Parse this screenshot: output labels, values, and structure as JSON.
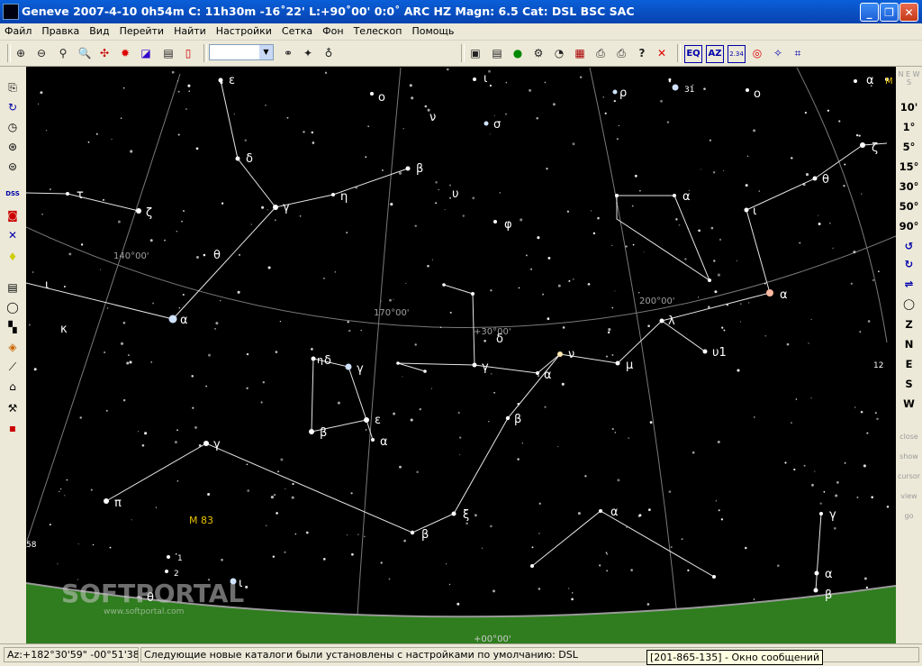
{
  "window": {
    "title": "Geneve 2007-4-10    0h54m C: 11h30m -16˚22' L:+90˚00' 0:0˚  ARC HZ  Magn: 6.5 Cat: DSL BSC SAC",
    "minimize": "_",
    "maximize": "❐",
    "close": "✕"
  },
  "menu": [
    "Файл",
    "Правка",
    "Вид",
    "Перейти",
    "Найти",
    "Настройки",
    "Сетка",
    "Фон",
    "Телескоп",
    "Помощь"
  ],
  "toolbar": {
    "combo_value": "",
    "buttons": [
      "zoom-in",
      "zoom-out",
      "zoom-fit",
      "find",
      "constellation",
      "sun",
      "night-mode",
      "info",
      "binoculars",
      "search-object",
      "search-person",
      "save",
      "text",
      "globe",
      "satellite",
      "clock",
      "calendar",
      "print",
      "print-setup",
      "help",
      "close",
      "eq",
      "az",
      "alt",
      "target",
      "constellation-lines"
    ],
    "eq_label": "EQ",
    "az_label": "AZ",
    "alt_label": "2.34"
  },
  "left_toolbar": [
    "copy",
    "refresh",
    "clock",
    "compass",
    "grid",
    "dss",
    "camera",
    "mirror",
    "bulb",
    "layers",
    "circle",
    "palette",
    "stats",
    "eyepiece",
    "telescope",
    "scope",
    "tools"
  ],
  "right_toolbar": {
    "fov": [
      "10'",
      "1°",
      "5°",
      "15°",
      "30°",
      "50°",
      "90°"
    ],
    "directions": [
      "Z",
      "N",
      "E",
      "S",
      "W"
    ],
    "gray": [
      "close",
      "show",
      "cursor",
      "view",
      "go"
    ],
    "top_marks": "N E W S"
  },
  "sky": {
    "bg": "#000000",
    "grid_labels": [
      "140°00'",
      "170°00'",
      "200°00'",
      "+30°00'",
      "+00°00'"
    ],
    "star_labels": {
      "eps1": "ε",
      "delta1": "δ",
      "gamma1": "γ",
      "eta1": "η",
      "beta1": "β",
      "zeta1": "ζ",
      "tau1": "τ",
      "theta1": "θ",
      "iota1": "ι",
      "alpha1": "α",
      "kappa1": "κ",
      "omicron1": "ο",
      "nu1": "ν",
      "sigma1": "σ",
      "upsilon1": "υ",
      "phi1": "φ",
      "iota2": "ι",
      "rho1": "ρ",
      "alpha2": "α",
      "iota3": "ι",
      "theta2": "θ",
      "zeta2": "ζ",
      "alpha3": "α",
      "eta2": "η",
      "delta2": "δ",
      "gamma2": "γ",
      "beta2": "β",
      "eps2": "ε",
      "alpha4": "α",
      "delta3": "δ",
      "gamma3": "γ",
      "nu2": "ν",
      "alpha5": "α",
      "mu1": "μ",
      "lambda1": "λ",
      "upsilon2": "υ1",
      "beta3": "β",
      "gamma4": "γ",
      "pi1": "π",
      "beta4": "β",
      "xi1": "ξ",
      "alpha6": "α",
      "gamma5": "γ",
      "alpha7": "α",
      "beta5": "β",
      "iota4": "ι",
      "theta3": "θ",
      "alpha8": "α",
      "m": "M"
    },
    "numbers": [
      "31",
      "12",
      "58",
      "1",
      "2"
    ],
    "m83": "M 83",
    "watermark": "SOFTPORTAL",
    "watermark_sub": "www.softportal.com"
  },
  "status": {
    "coords": "Az:+182°30'59\" -00°51'38\"",
    "message": "Следующие новые каталоги были установлены с настройками по умолчанию:  DSL",
    "popup": "[201-865-135] - Окно сообщений"
  },
  "colors": {
    "title": "#0842b0",
    "ground": "#2f7d1e",
    "horizon": "#808080"
  }
}
